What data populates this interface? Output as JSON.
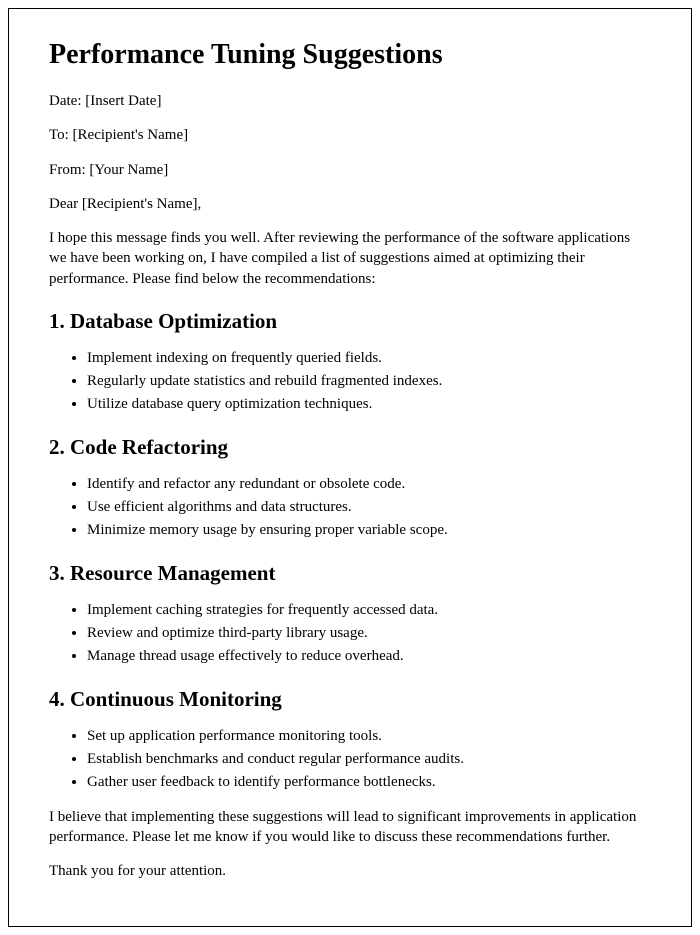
{
  "title": "Performance Tuning Suggestions",
  "date_line": "Date: [Insert Date]",
  "to_line": "To: [Recipient's Name]",
  "from_line": "From: [Your Name]",
  "salutation": "Dear [Recipient's Name],",
  "intro": "I hope this message finds you well. After reviewing the performance of the software applications we have been working on, I have compiled a list of suggestions aimed at optimizing their performance. Please find below the recommendations:",
  "sections": [
    {
      "heading": "1. Database Optimization",
      "items": [
        "Implement indexing on frequently queried fields.",
        "Regularly update statistics and rebuild fragmented indexes.",
        "Utilize database query optimization techniques."
      ]
    },
    {
      "heading": "2. Code Refactoring",
      "items": [
        "Identify and refactor any redundant or obsolete code.",
        "Use efficient algorithms and data structures.",
        "Minimize memory usage by ensuring proper variable scope."
      ]
    },
    {
      "heading": "3. Resource Management",
      "items": [
        "Implement caching strategies for frequently accessed data.",
        "Review and optimize third-party library usage.",
        "Manage thread usage effectively to reduce overhead."
      ]
    },
    {
      "heading": "4. Continuous Monitoring",
      "items": [
        "Set up application performance monitoring tools.",
        "Establish benchmarks and conduct regular performance audits.",
        "Gather user feedback to identify performance bottlenecks."
      ]
    }
  ],
  "closing": "I believe that implementing these suggestions will lead to significant improvements in application performance. Please let me know if you would like to discuss these recommendations further.",
  "thanks": "Thank you for your attention."
}
